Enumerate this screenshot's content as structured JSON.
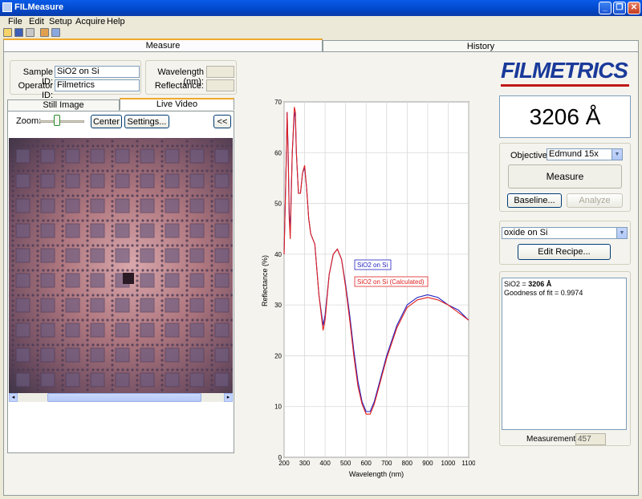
{
  "window": {
    "title": "FILMeasure",
    "minimize_glyph": "_",
    "restore_glyph": "❐",
    "close_glyph": "✕"
  },
  "menu": [
    "File",
    "Edit",
    "Setup",
    "Acquire",
    "Help"
  ],
  "toolbar": {
    "icons": [
      "open-icon",
      "save-icon",
      "print-icon",
      "settings-icon",
      "copy-icon"
    ]
  },
  "tabs": {
    "measure": "Measure",
    "history": "History"
  },
  "sample": {
    "sample_id_label": "Sample ID:",
    "sample_id_value": "SiO2 on Si",
    "operator_id_label": "Operator ID:",
    "operator_id_value": "Filmetrics",
    "wavelength_label": "Wavelength (nm):",
    "wavelength_value": "",
    "reflectance_label": "Reflectance:",
    "reflectance_value": ""
  },
  "camera": {
    "tab_still": "Still Image",
    "tab_live": "Live Video",
    "zoom_label": "Zoom:",
    "zoom_level": 0.35,
    "center_label": "Center",
    "settings_label": "Settings...",
    "collapse_label": "<<"
  },
  "brand": {
    "logo_text": "FILMETRICS",
    "color": "#1a3a9a"
  },
  "result": {
    "thickness": "3206 Å"
  },
  "controls": {
    "objective_label": "Objective:",
    "objective_value": "Edmund 15x",
    "measure_label": "Measure",
    "baseline_label": "Baseline...",
    "analyze_label": "Analyze"
  },
  "recipe": {
    "value": "oxide on Si",
    "edit_label": "Edit Recipe..."
  },
  "output": {
    "line1_prefix": "SiO2 = ",
    "line1_value": "3206 Å",
    "line2": "Goodness of fit = 0.9974"
  },
  "measurement": {
    "label": "Measurement #",
    "value": "457"
  },
  "chart_data": {
    "type": "line",
    "xlabel": "Wavelength (nm)",
    "ylabel": "Reflectance (%)",
    "xlim": [
      200,
      1100
    ],
    "ylim": [
      0,
      70
    ],
    "xticks": [
      200,
      300,
      400,
      500,
      600,
      700,
      800,
      900,
      1000,
      1100
    ],
    "yticks": [
      0,
      10,
      20,
      30,
      40,
      50,
      60,
      70
    ],
    "grid": true,
    "legend_position": "center-right",
    "series": [
      {
        "name": "SiO2 on Si",
        "color": "#2020c0",
        "x": [
          200,
          210,
          215,
          220,
          225,
          230,
          240,
          250,
          255,
          260,
          270,
          280,
          290,
          300,
          310,
          320,
          330,
          350,
          370,
          390,
          400,
          420,
          440,
          460,
          480,
          500,
          520,
          540,
          560,
          580,
          600,
          620,
          640,
          660,
          680,
          700,
          750,
          800,
          850,
          900,
          950,
          1000,
          1050,
          1100
        ],
        "y": [
          40,
          58,
          68,
          60,
          48,
          45,
          60,
          68,
          67,
          60,
          52,
          52,
          56,
          57,
          53,
          47,
          44,
          42,
          32,
          26,
          28,
          36,
          40,
          41,
          39,
          34,
          28,
          21,
          15,
          11,
          9,
          9,
          11,
          14,
          17,
          20,
          26,
          30,
          31.5,
          32,
          31.5,
          30,
          29,
          27
        ]
      },
      {
        "name": "SiO2 on Si (Calculated)",
        "color": "#e02020",
        "x": [
          200,
          210,
          215,
          220,
          225,
          230,
          240,
          250,
          255,
          260,
          270,
          280,
          290,
          300,
          310,
          320,
          330,
          350,
          370,
          390,
          400,
          420,
          440,
          460,
          480,
          500,
          520,
          540,
          560,
          580,
          600,
          620,
          640,
          660,
          680,
          700,
          750,
          800,
          850,
          900,
          950,
          1000,
          1050,
          1100
        ],
        "y": [
          40,
          58,
          68,
          59,
          47,
          43,
          60,
          69,
          68,
          60,
          52,
          52,
          56,
          57.5,
          53,
          47,
          44,
          42,
          32,
          25,
          27,
          36,
          40,
          41,
          39,
          33.5,
          27,
          20,
          14,
          10.5,
          8.5,
          8.5,
          10.5,
          13.5,
          16.5,
          19.5,
          25.5,
          29.5,
          31,
          31.5,
          31,
          30,
          28.5,
          27
        ]
      }
    ]
  }
}
